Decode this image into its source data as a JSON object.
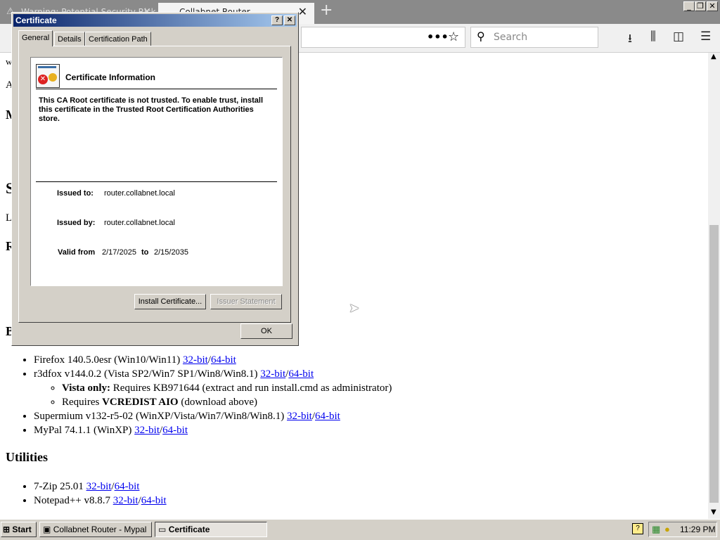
{
  "browser": {
    "tabs": [
      {
        "label": "Warning: Potential Security Risk"
      },
      {
        "label": "Collabnet Router"
      }
    ],
    "search_placeholder": "Search"
  },
  "page": {
    "browsers_list": [
      {
        "name": "Firefox 140.5.0esr (Win10/Win11)",
        "link32": "32-bit",
        "link64": "64-bit"
      },
      {
        "name": "r3dfox v144.0.2 (Vista SP2/Win7 SP1/Win8/Win8.1)",
        "link32": "32-bit",
        "link64": "64-bit"
      },
      {
        "name": "Supermium v132-r5-02 (WinXP/Vista/Win7/Win8/Win8.1)",
        "link32": "32-bit",
        "link64": "64-bit"
      },
      {
        "name": "MyPal 74.1.1 (WinXP)",
        "link32": "32-bit",
        "link64": "64-bit"
      }
    ],
    "r3dfox_notes": {
      "vista_label": "Vista only:",
      "vista_text": "Requires KB971644 (extract and run install.cmd as administrator)",
      "requires_prefix": "Requires",
      "requires_bold": "VCREDIST AIO",
      "requires_suffix": "(download above)"
    },
    "utilities_heading": "Utilities",
    "utilities_list": [
      {
        "name": "7-Zip 25.01",
        "link32": "32-bit",
        "link64": "64-bit"
      },
      {
        "name": "Notepad++ v8.8.7",
        "link32": "32-bit",
        "link64": "64-bit"
      }
    ],
    "link_separator": "/",
    "left_fragments": [
      "w",
      "A",
      "M",
      "S",
      "L",
      "R",
      "B"
    ]
  },
  "dialog": {
    "title": "Certificate",
    "help_glyph": "?",
    "close_glyph": "✕",
    "tabs": [
      "General",
      "Details",
      "Certification Path"
    ],
    "info_title": "Certificate Information",
    "warning": "This CA Root certificate is not trusted. To enable trust, install this certificate in the Trusted Root Certification Authorities store.",
    "issued_to_label": "Issued to:",
    "issued_to": "router.collabnet.local",
    "issued_by_label": "Issued by:",
    "issued_by": "router.collabnet.local",
    "valid_from_label": "Valid from",
    "valid_from": "2/17/2025",
    "to_label": "to",
    "valid_to": "2/15/2035",
    "install_button": "Install Certificate...",
    "issuer_button": "Issuer Statement",
    "ok_button": "OK"
  },
  "taskbar": {
    "start": "Start",
    "items": [
      "Collabnet Router - Mypal",
      "Certificate"
    ],
    "clock": "11:29 PM"
  }
}
